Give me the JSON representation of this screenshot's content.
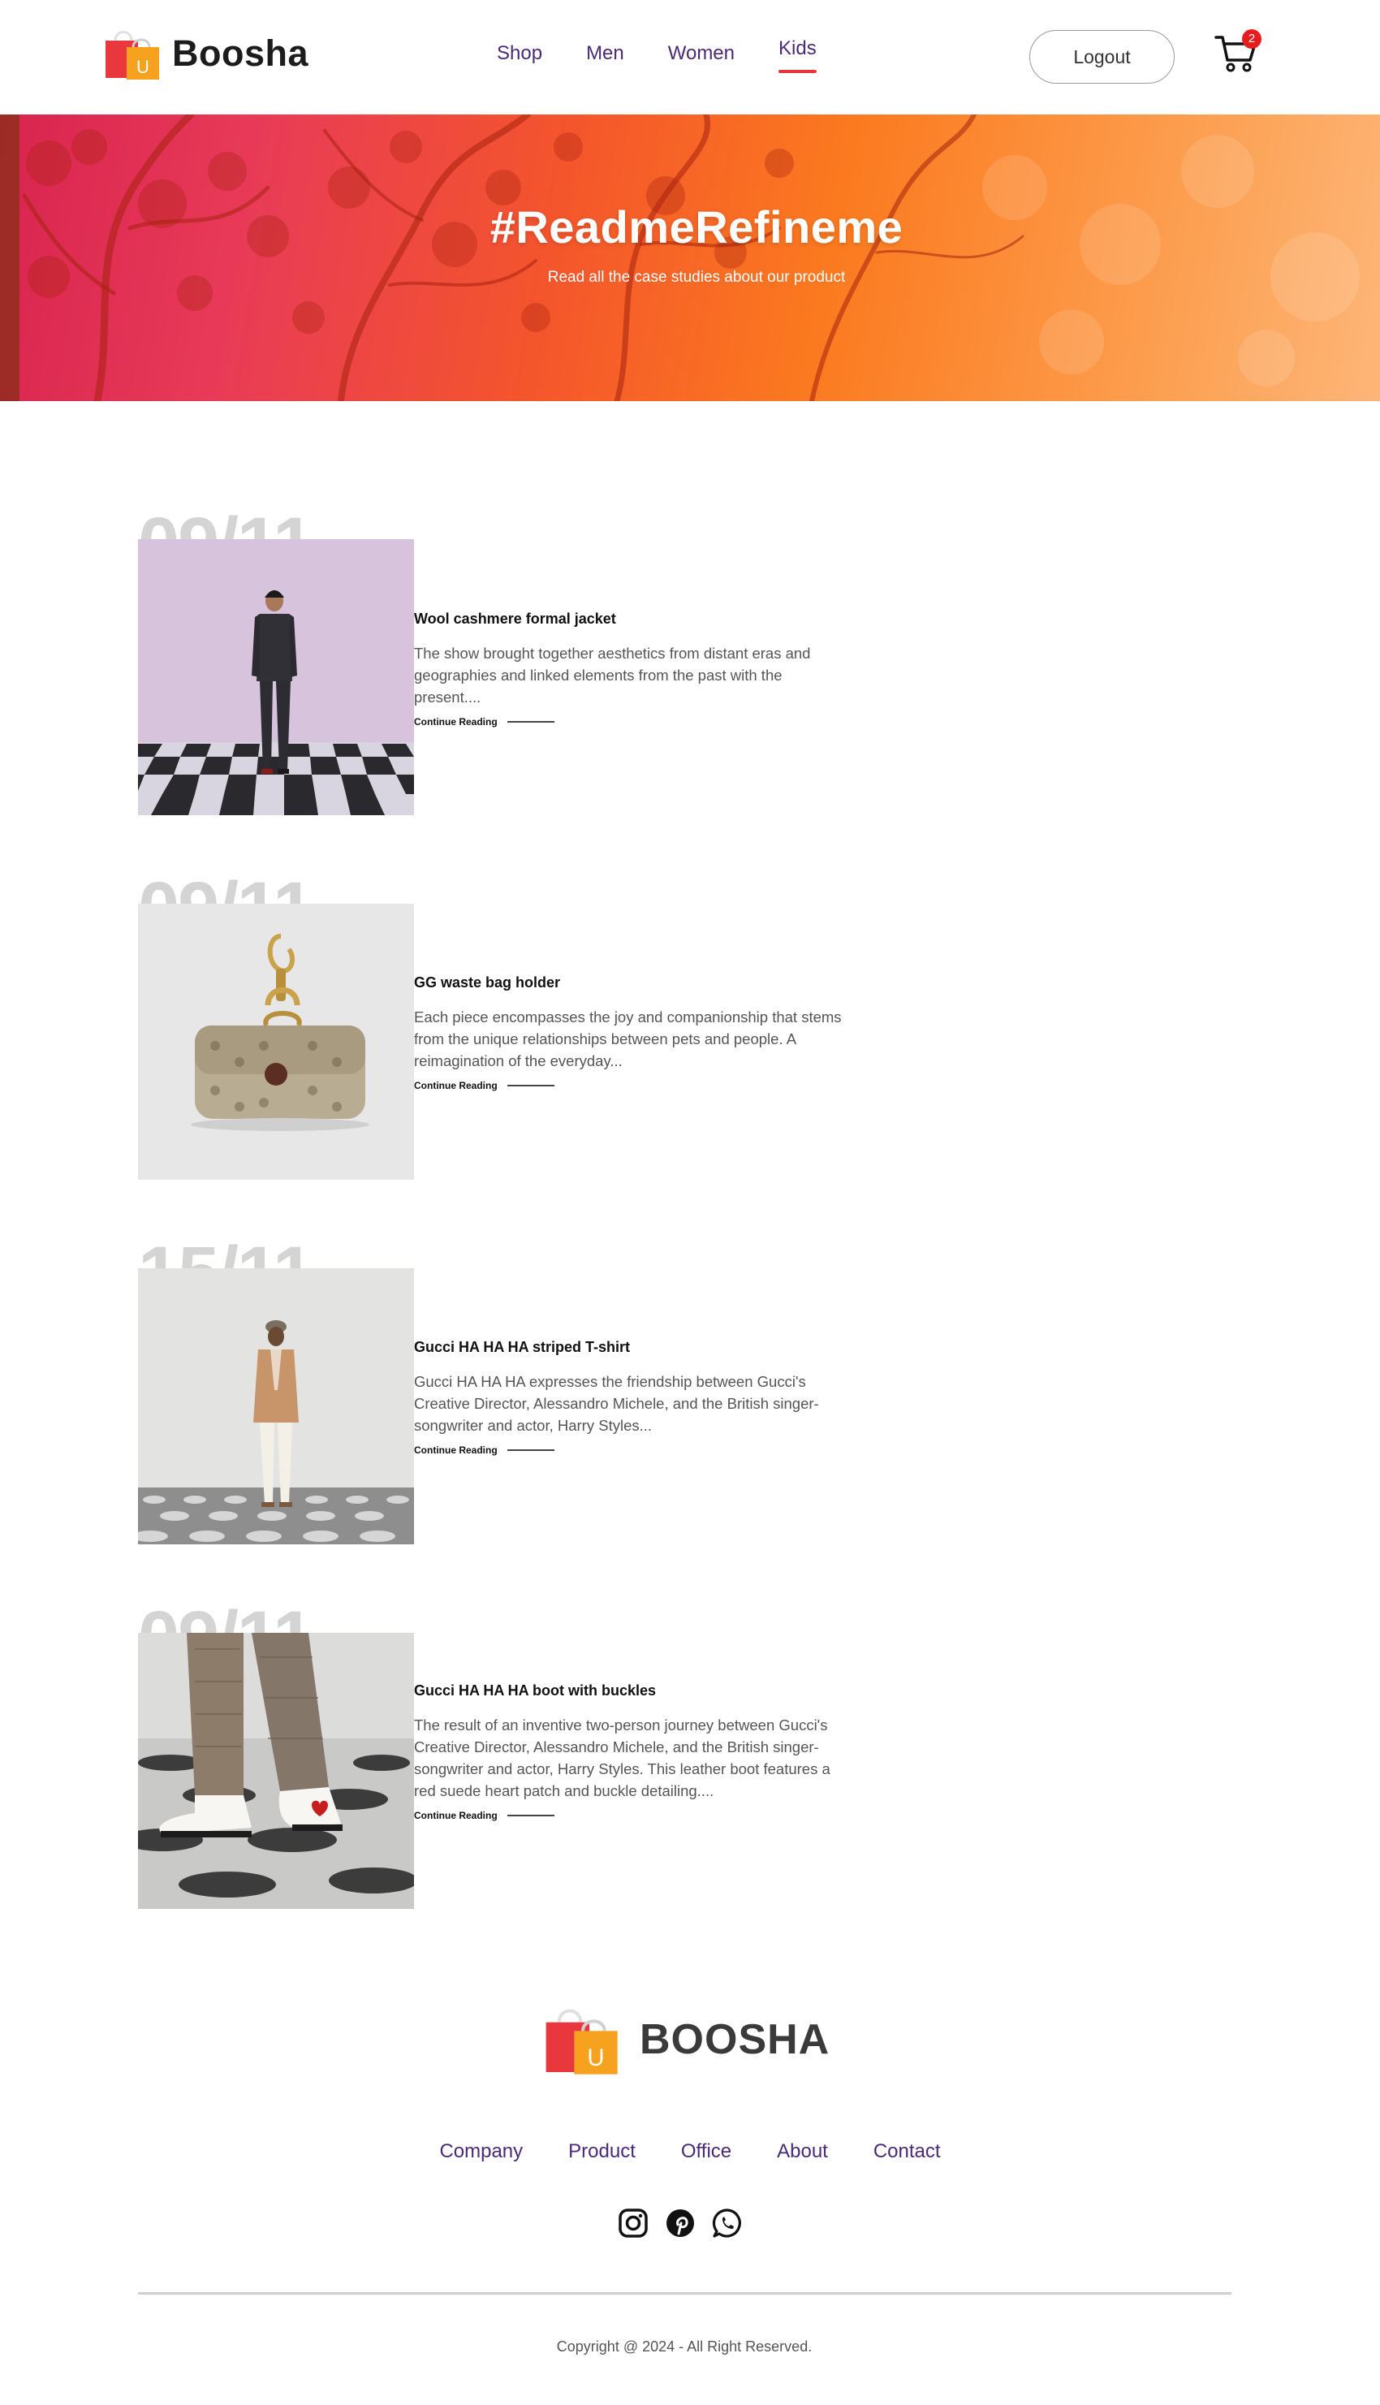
{
  "header": {
    "brand": "Boosha",
    "nav": [
      {
        "label": "Shop",
        "active": false
      },
      {
        "label": "Men",
        "active": false
      },
      {
        "label": "Women",
        "active": false
      },
      {
        "label": "Kids",
        "active": true
      }
    ],
    "logout_label": "Logout",
    "cart_count": "2"
  },
  "hero": {
    "title": "#ReadmeRefineme",
    "subtitle": "Read all the case studies about our product"
  },
  "posts": [
    {
      "date": "09/11",
      "title": "Wool cashmere formal jacket",
      "excerpt": "The show brought together aesthetics from distant eras and geographies and linked elements from the past with the present....",
      "cta": "Continue Reading",
      "image": "man-in-dark-suit-on-checkered-floor"
    },
    {
      "date": "09/11",
      "title": "GG waste bag holder",
      "excerpt": "Each piece encompasses the joy and companionship that stems from the unique relationships between pets and people. A reimagination of the everyday...",
      "cta": "Continue Reading",
      "image": "gg-canvas-bag-holder-with-gold-clasp"
    },
    {
      "date": "15/11",
      "title": "Gucci HA HA HA striped T-shirt",
      "excerpt": "Gucci HA HA HA expresses the friendship between Gucci's Creative Director, Alessandro Michele, and the British singer-songwriter and actor, Harry Styles...",
      "cta": "Continue Reading",
      "image": "man-in-camel-blazer-on-dotted-floor"
    },
    {
      "date": "09/11",
      "title": "Gucci HA HA HA boot with buckles",
      "excerpt": "The result of an inventive two-person journey between Gucci's Creative Director, Alessandro Michele, and the British singer-songwriter and actor, Harry Styles. This leather boot features a red suede heart patch and buckle detailing....",
      "cta": "Continue Reading",
      "image": "white-boots-with-red-heart-patch"
    }
  ],
  "footer": {
    "brand": "BOOSHA",
    "nav": [
      "Company",
      "Product",
      "Office",
      "About",
      "Contact"
    ],
    "socials": [
      "instagram-icon",
      "pinterest-icon",
      "whatsapp-icon"
    ],
    "copyright": "Copyright @ 2024 - All Right Reserved."
  },
  "colors": {
    "nav_text": "#4a2a78",
    "active_underline": "#e8363b",
    "cart_badge": "#e51d1d",
    "hero_gradient": [
      "#d8244f",
      "#f4552c",
      "#fb7a1f",
      "#fdb678"
    ]
  }
}
